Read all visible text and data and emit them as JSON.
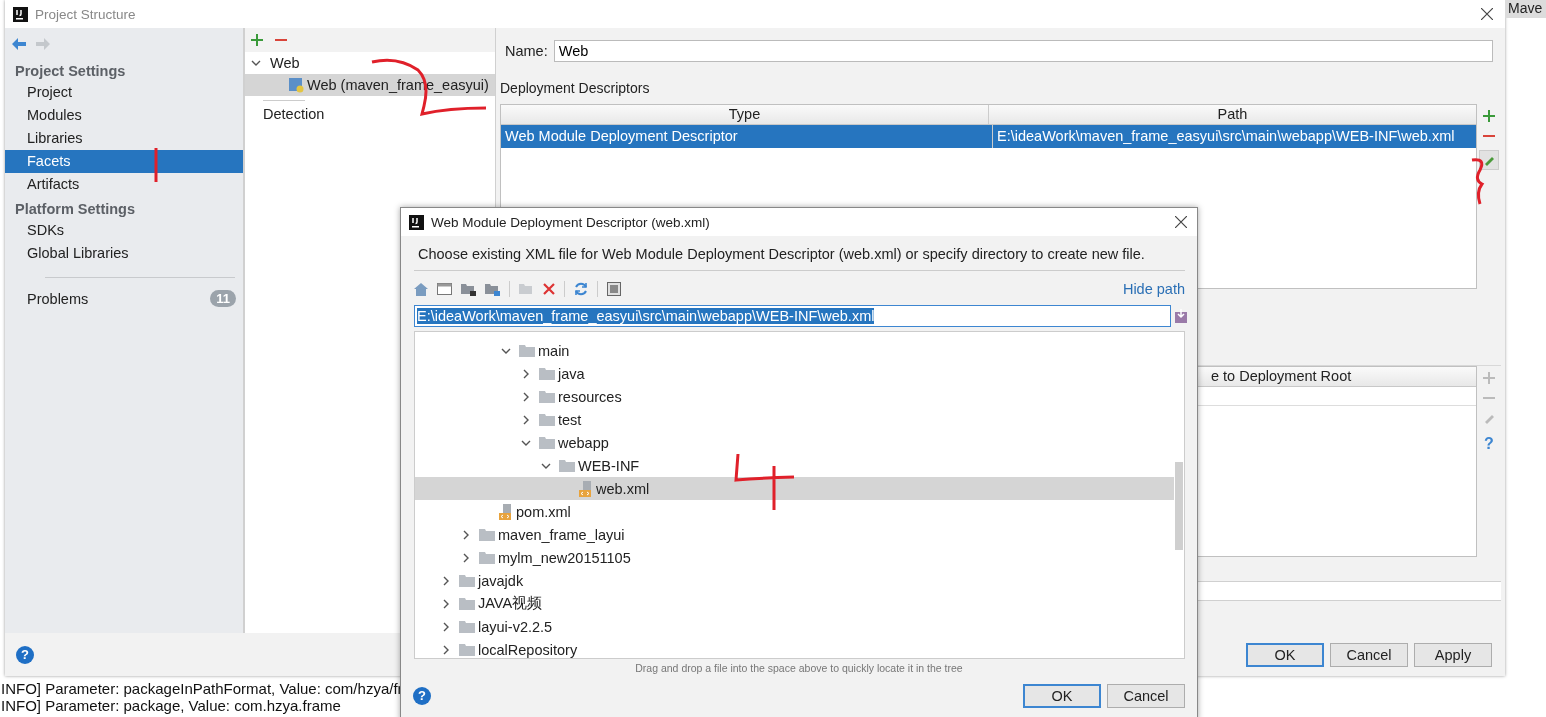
{
  "main_window": {
    "title": "Project Structure",
    "sidebar": {
      "sections": [
        {
          "heading": "Project Settings",
          "items": [
            {
              "label": "Project",
              "selected": false
            },
            {
              "label": "Modules",
              "selected": false
            },
            {
              "label": "Libraries",
              "selected": false
            },
            {
              "label": "Facets",
              "selected": true
            },
            {
              "label": "Artifacts",
              "selected": false
            }
          ]
        },
        {
          "heading": "Platform Settings",
          "items": [
            {
              "label": "SDKs",
              "selected": false
            },
            {
              "label": "Global Libraries",
              "selected": false
            }
          ]
        }
      ],
      "problems": {
        "label": "Problems",
        "count": "11"
      }
    },
    "facets_tree": {
      "items": [
        {
          "label": "Web",
          "expanded": true,
          "children": [
            {
              "label": "Web (maven_frame_easyui)",
              "selected": true
            }
          ]
        }
      ],
      "detection": "Detection"
    },
    "name_field": {
      "label": "Name:",
      "value": "Web"
    },
    "deployment_descriptors": {
      "heading": "Deployment Descriptors",
      "columns": [
        "Type",
        "Path"
      ],
      "rows": [
        {
          "type": "Web Module Deployment Descriptor",
          "path": "E:\\ideaWork\\maven_frame_easyui\\src\\main\\webapp\\WEB-INF\\web.xml",
          "selected": true
        }
      ]
    },
    "resources_table": {
      "column": "e to Deployment Root",
      "help": "?"
    },
    "help": "?",
    "buttons": [
      {
        "label": "OK",
        "default": true
      },
      {
        "label": "Cancel",
        "default": false
      },
      {
        "label": "Apply",
        "default": false
      }
    ]
  },
  "dialog": {
    "title": "Web Module Deployment Descriptor (web.xml)",
    "description": "Choose existing XML file for Web Module Deployment Descriptor (web.xml) or specify directory to create new file.",
    "hide_path": "Hide path",
    "path_value": "E:\\ideaWork\\maven_frame_easyui\\src\\main\\webapp\\WEB-INF\\web.xml",
    "tree": [
      {
        "children": [
          {
            "children": [
              {
                "children": [
                  {
                    "label": "main",
                    "kind": "folder",
                    "expanded": true,
                    "selected": false,
                    "children": [
                      {
                        "label": "java",
                        "kind": "folder",
                        "expanded": false,
                        "selected": false
                      },
                      {
                        "label": "resources",
                        "kind": "folder",
                        "expanded": false,
                        "selected": false
                      },
                      {
                        "label": "test",
                        "kind": "folder",
                        "expanded": false,
                        "selected": false
                      },
                      {
                        "label": "webapp",
                        "kind": "folder",
                        "expanded": true,
                        "selected": false,
                        "children": [
                          {
                            "label": "WEB-INF",
                            "kind": "folder",
                            "expanded": true,
                            "selected": false,
                            "children": [
                              {
                                "label": "web.xml",
                                "kind": "file",
                                "selected": true
                              }
                            ]
                          }
                        ]
                      }
                    ]
                  }
                ]
              },
              {
                "label": "pom.xml",
                "kind": "file",
                "selected": false
              }
            ]
          },
          {
            "label": "maven_frame_layui",
            "kind": "folder",
            "expanded": false,
            "selected": false
          },
          {
            "label": "mylm_new20151105",
            "kind": "folder",
            "expanded": false,
            "selected": false
          }
        ]
      },
      {
        "label": "javajdk",
        "kind": "folder",
        "expanded": false,
        "selected": false
      },
      {
        "label": "JAVA视频",
        "kind": "folder",
        "expanded": false,
        "selected": false
      },
      {
        "label": "layui-v2.2.5",
        "kind": "folder",
        "expanded": false,
        "selected": false
      },
      {
        "label": "localRepository",
        "kind": "folder",
        "expanded": false,
        "selected": false
      }
    ],
    "help": "?",
    "hint": "Drag and drop a file into the space above to quickly locate it in the tree",
    "buttons": [
      {
        "label": "OK",
        "default": true
      },
      {
        "label": "Cancel",
        "default": false
      }
    ]
  },
  "background_window": {
    "tab": "Mave"
  },
  "console": {
    "lines": [
      "INFO] Parameter: packageInPathFormat, Value: com/hzya/fr",
      "INFO] Parameter: package, Value: com.hzya.frame"
    ]
  }
}
